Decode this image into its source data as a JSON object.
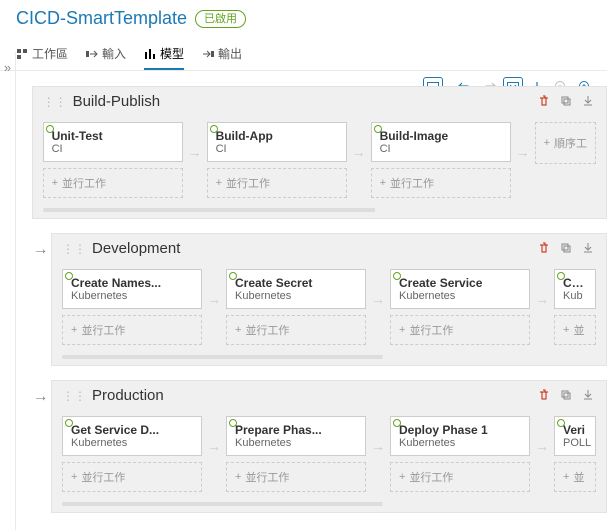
{
  "header": {
    "title": "CICD-SmartTemplate",
    "status_badge": "已啟用"
  },
  "tabs": [
    {
      "label": "工作區",
      "active": false
    },
    {
      "label": "輸入",
      "active": false
    },
    {
      "label": "模型",
      "active": true
    },
    {
      "label": "輸出",
      "active": false
    }
  ],
  "labels": {
    "parallel": "並行工作",
    "sequential": "順序工"
  },
  "stages": [
    {
      "name": "Build-Publish",
      "show_arrow": false,
      "columns": [
        {
          "task": {
            "name": "Unit-Test",
            "type": "CI"
          }
        },
        {
          "task": {
            "name": "Build-App",
            "type": "CI"
          }
        },
        {
          "task": {
            "name": "Build-Image",
            "type": "CI"
          }
        }
      ],
      "sequential_visible": true
    },
    {
      "name": "Development",
      "show_arrow": true,
      "columns": [
        {
          "task": {
            "name": "Create Names...",
            "type": "Kubernetes"
          }
        },
        {
          "task": {
            "name": "Create Secret",
            "type": "Kubernetes"
          }
        },
        {
          "task": {
            "name": "Create Service",
            "type": "Kubernetes"
          }
        },
        {
          "task": {
            "name": "Crea",
            "type": "Kub"
          },
          "truncated": true
        }
      ],
      "sequential_visible": false
    },
    {
      "name": "Production",
      "show_arrow": true,
      "columns": [
        {
          "task": {
            "name": "Get Service D...",
            "type": "Kubernetes"
          }
        },
        {
          "task": {
            "name": "Prepare Phas...",
            "type": "Kubernetes"
          }
        },
        {
          "task": {
            "name": "Deploy Phase 1",
            "type": "Kubernetes"
          }
        },
        {
          "task": {
            "name": "Veri",
            "type": "POLL"
          },
          "truncated": true
        }
      ],
      "sequential_visible": false
    }
  ]
}
